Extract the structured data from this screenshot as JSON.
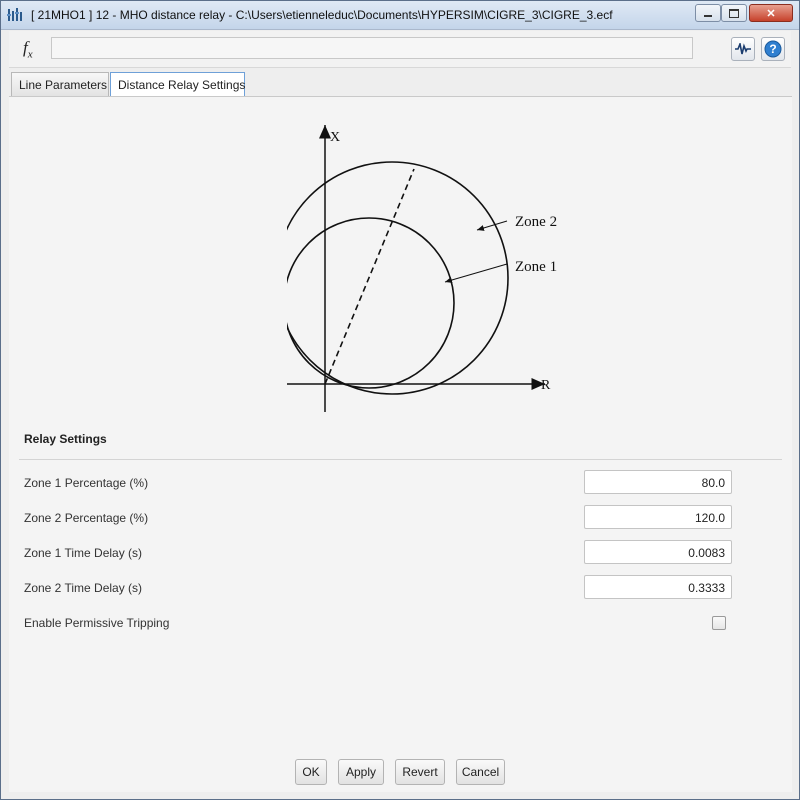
{
  "window": {
    "title": "[ 21MHO1 ]  12 - MHO distance relay - C:\\Users\\etienneleduc\\Documents\\HYPERSIM\\CIGRE_3\\CIGRE_3.ecf",
    "controls": [
      "minimize-icon",
      "maximize-icon",
      "close-icon"
    ]
  },
  "toolbar": {
    "fx_label": "f",
    "fx_sub": "x",
    "formula_value": "",
    "icons": [
      "waveform-icon",
      "help-icon"
    ]
  },
  "tabs": [
    {
      "label": "Line Parameters",
      "active": false
    },
    {
      "label": "Distance Relay Settings",
      "active": true
    }
  ],
  "diagram": {
    "x_axis_label": "R",
    "y_axis_label": "X",
    "zone1_label": "Zone 1",
    "zone2_label": "Zone 2"
  },
  "settings": {
    "section_title": "Relay Settings",
    "fields": [
      {
        "label": "Zone 1 Percentage (%)",
        "value": "80.0"
      },
      {
        "label": "Zone 2 Percentage (%)",
        "value": "120.0"
      },
      {
        "label": "Zone 1 Time Delay (s)",
        "value": "0.0083"
      },
      {
        "label": "Zone 2 Time Delay (s)",
        "value": "0.3333"
      }
    ],
    "permissive": {
      "label": "Enable Permissive Tripping",
      "checked": false
    }
  },
  "buttons": {
    "ok": "OK",
    "apply": "Apply",
    "revert": "Revert",
    "cancel": "Cancel"
  }
}
